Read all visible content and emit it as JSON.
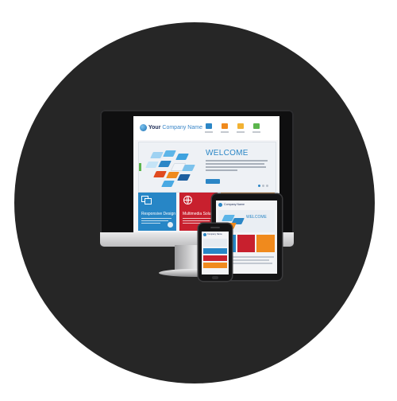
{
  "site": {
    "logo_bold": "Your",
    "logo_light": "Company Name",
    "hero_title": "WELCOME",
    "tiles": [
      {
        "title": "Responsive Design"
      },
      {
        "title": "Multimedia Solutions"
      }
    ]
  },
  "tablet": {
    "hero_title": "WELCOME"
  },
  "colors": {
    "background_circle": "#262626",
    "brand_blue": "#2786c6",
    "brand_red": "#c8202e",
    "brand_orange": "#f08a1d",
    "brand_green": "#5bb54c"
  }
}
